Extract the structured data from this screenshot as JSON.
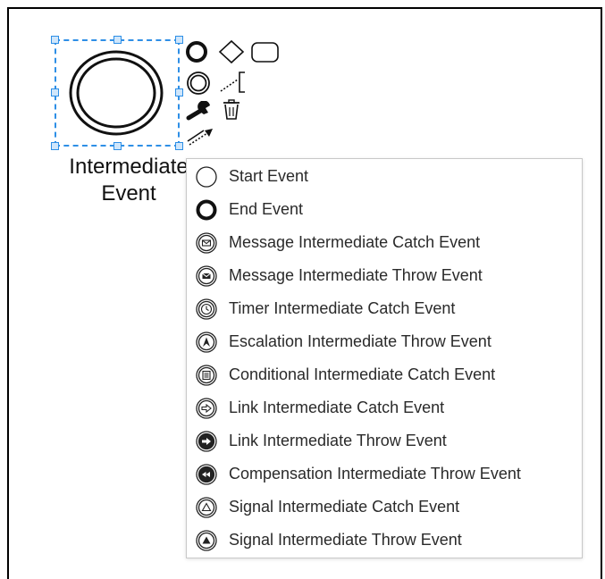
{
  "element": {
    "label_line1": "Intermediate",
    "label_line2": "Event"
  },
  "context_pad": [
    {
      "name": "end-event-tool-icon",
      "icon": "thick-circle"
    },
    {
      "name": "gateway-tool-icon",
      "icon": "diamond"
    },
    {
      "name": "task-tool-icon",
      "icon": "rounded-rect"
    },
    {
      "name": "intermediate-event-tool-icon",
      "icon": "double-circle"
    },
    {
      "name": "text-annotation-tool-icon",
      "icon": "annotation-bracket"
    },
    {
      "name": "change-type-wrench-icon",
      "icon": "wrench"
    },
    {
      "name": "delete-trash-icon",
      "icon": "trash"
    },
    {
      "name": "connect-arrow-icon",
      "icon": "dotted-arrow"
    }
  ],
  "replace_menu": {
    "items": [
      {
        "label": "Start Event",
        "icon": "start-event"
      },
      {
        "label": "End Event",
        "icon": "end-event"
      },
      {
        "label": "Message Intermediate Catch Event",
        "icon": "message-catch"
      },
      {
        "label": "Message Intermediate Throw Event",
        "icon": "message-throw"
      },
      {
        "label": "Timer Intermediate Catch Event",
        "icon": "timer-catch"
      },
      {
        "label": "Escalation Intermediate Throw Event",
        "icon": "escalation-throw"
      },
      {
        "label": "Conditional Intermediate Catch Event",
        "icon": "conditional-catch"
      },
      {
        "label": "Link Intermediate Catch Event",
        "icon": "link-catch"
      },
      {
        "label": "Link Intermediate Throw Event",
        "icon": "link-throw"
      },
      {
        "label": "Compensation Intermediate Throw Event",
        "icon": "compensation-throw"
      },
      {
        "label": "Signal Intermediate Catch Event",
        "icon": "signal-catch"
      },
      {
        "label": "Signal Intermediate Throw Event",
        "icon": "signal-throw"
      }
    ]
  },
  "colors": {
    "selection": "#2e8fe6",
    "text": "#222222",
    "border": "#000000"
  }
}
